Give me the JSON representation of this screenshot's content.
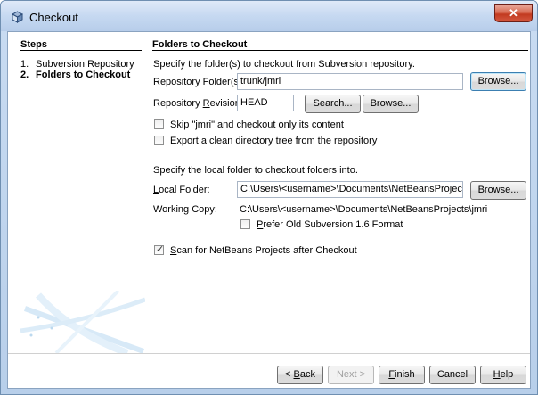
{
  "window": {
    "title": "Checkout",
    "close_glyph": "✕",
    "title_icon": "cube-icon"
  },
  "steps": {
    "title": "Steps",
    "items": [
      {
        "num": "1.",
        "label": "Subversion Repository"
      },
      {
        "num": "2.",
        "label": "Folders to Checkout"
      }
    ]
  },
  "content": {
    "title": "Folders to Checkout",
    "intro": "Specify the folder(s) to checkout from Subversion repository.",
    "repo_folder": {
      "label_pre": "Repository Fold",
      "label_mn": "e",
      "label_post": "r(s):",
      "value": "trunk/jmri",
      "browse": "Browse..."
    },
    "repo_revision": {
      "label_pre": "Repository ",
      "label_mn": "R",
      "label_post": "evision:",
      "value": "HEAD",
      "search": "Search...",
      "browse": "Browse..."
    },
    "skip_checkbox": {
      "label": "Skip \"jmri\" and checkout only its content",
      "checked": false
    },
    "export_checkbox": {
      "label": "Export a clean directory tree from the repository",
      "checked": false
    },
    "local_intro": "Specify the local folder to checkout folders into.",
    "local_folder": {
      "label_pre": "",
      "label_mn": "L",
      "label_post": "ocal Folder:",
      "value": "C:\\Users\\<username>\\Documents\\NetBeansProjects",
      "browse": "Browse..."
    },
    "working_copy": {
      "label": "Working Copy:",
      "value": "C:\\Users\\<username>\\Documents\\NetBeansProjects\\jmri"
    },
    "prefer_checkbox": {
      "label_pre": "",
      "label_mn": "P",
      "label_post": "refer Old Subversion 1.6 Format",
      "checked": false
    },
    "scan_checkbox": {
      "label_pre": "",
      "label_mn": "S",
      "label_post": "can for NetBeans Projects after Checkout",
      "checked": true
    }
  },
  "footer": {
    "back": {
      "pre": "< ",
      "mn": "B",
      "post": "ack"
    },
    "next": "Next >",
    "finish": {
      "pre": "",
      "mn": "F",
      "post": "inish"
    },
    "cancel": "Cancel",
    "help": {
      "pre": "",
      "mn": "H",
      "post": "elp"
    }
  },
  "checkmark": "✓"
}
